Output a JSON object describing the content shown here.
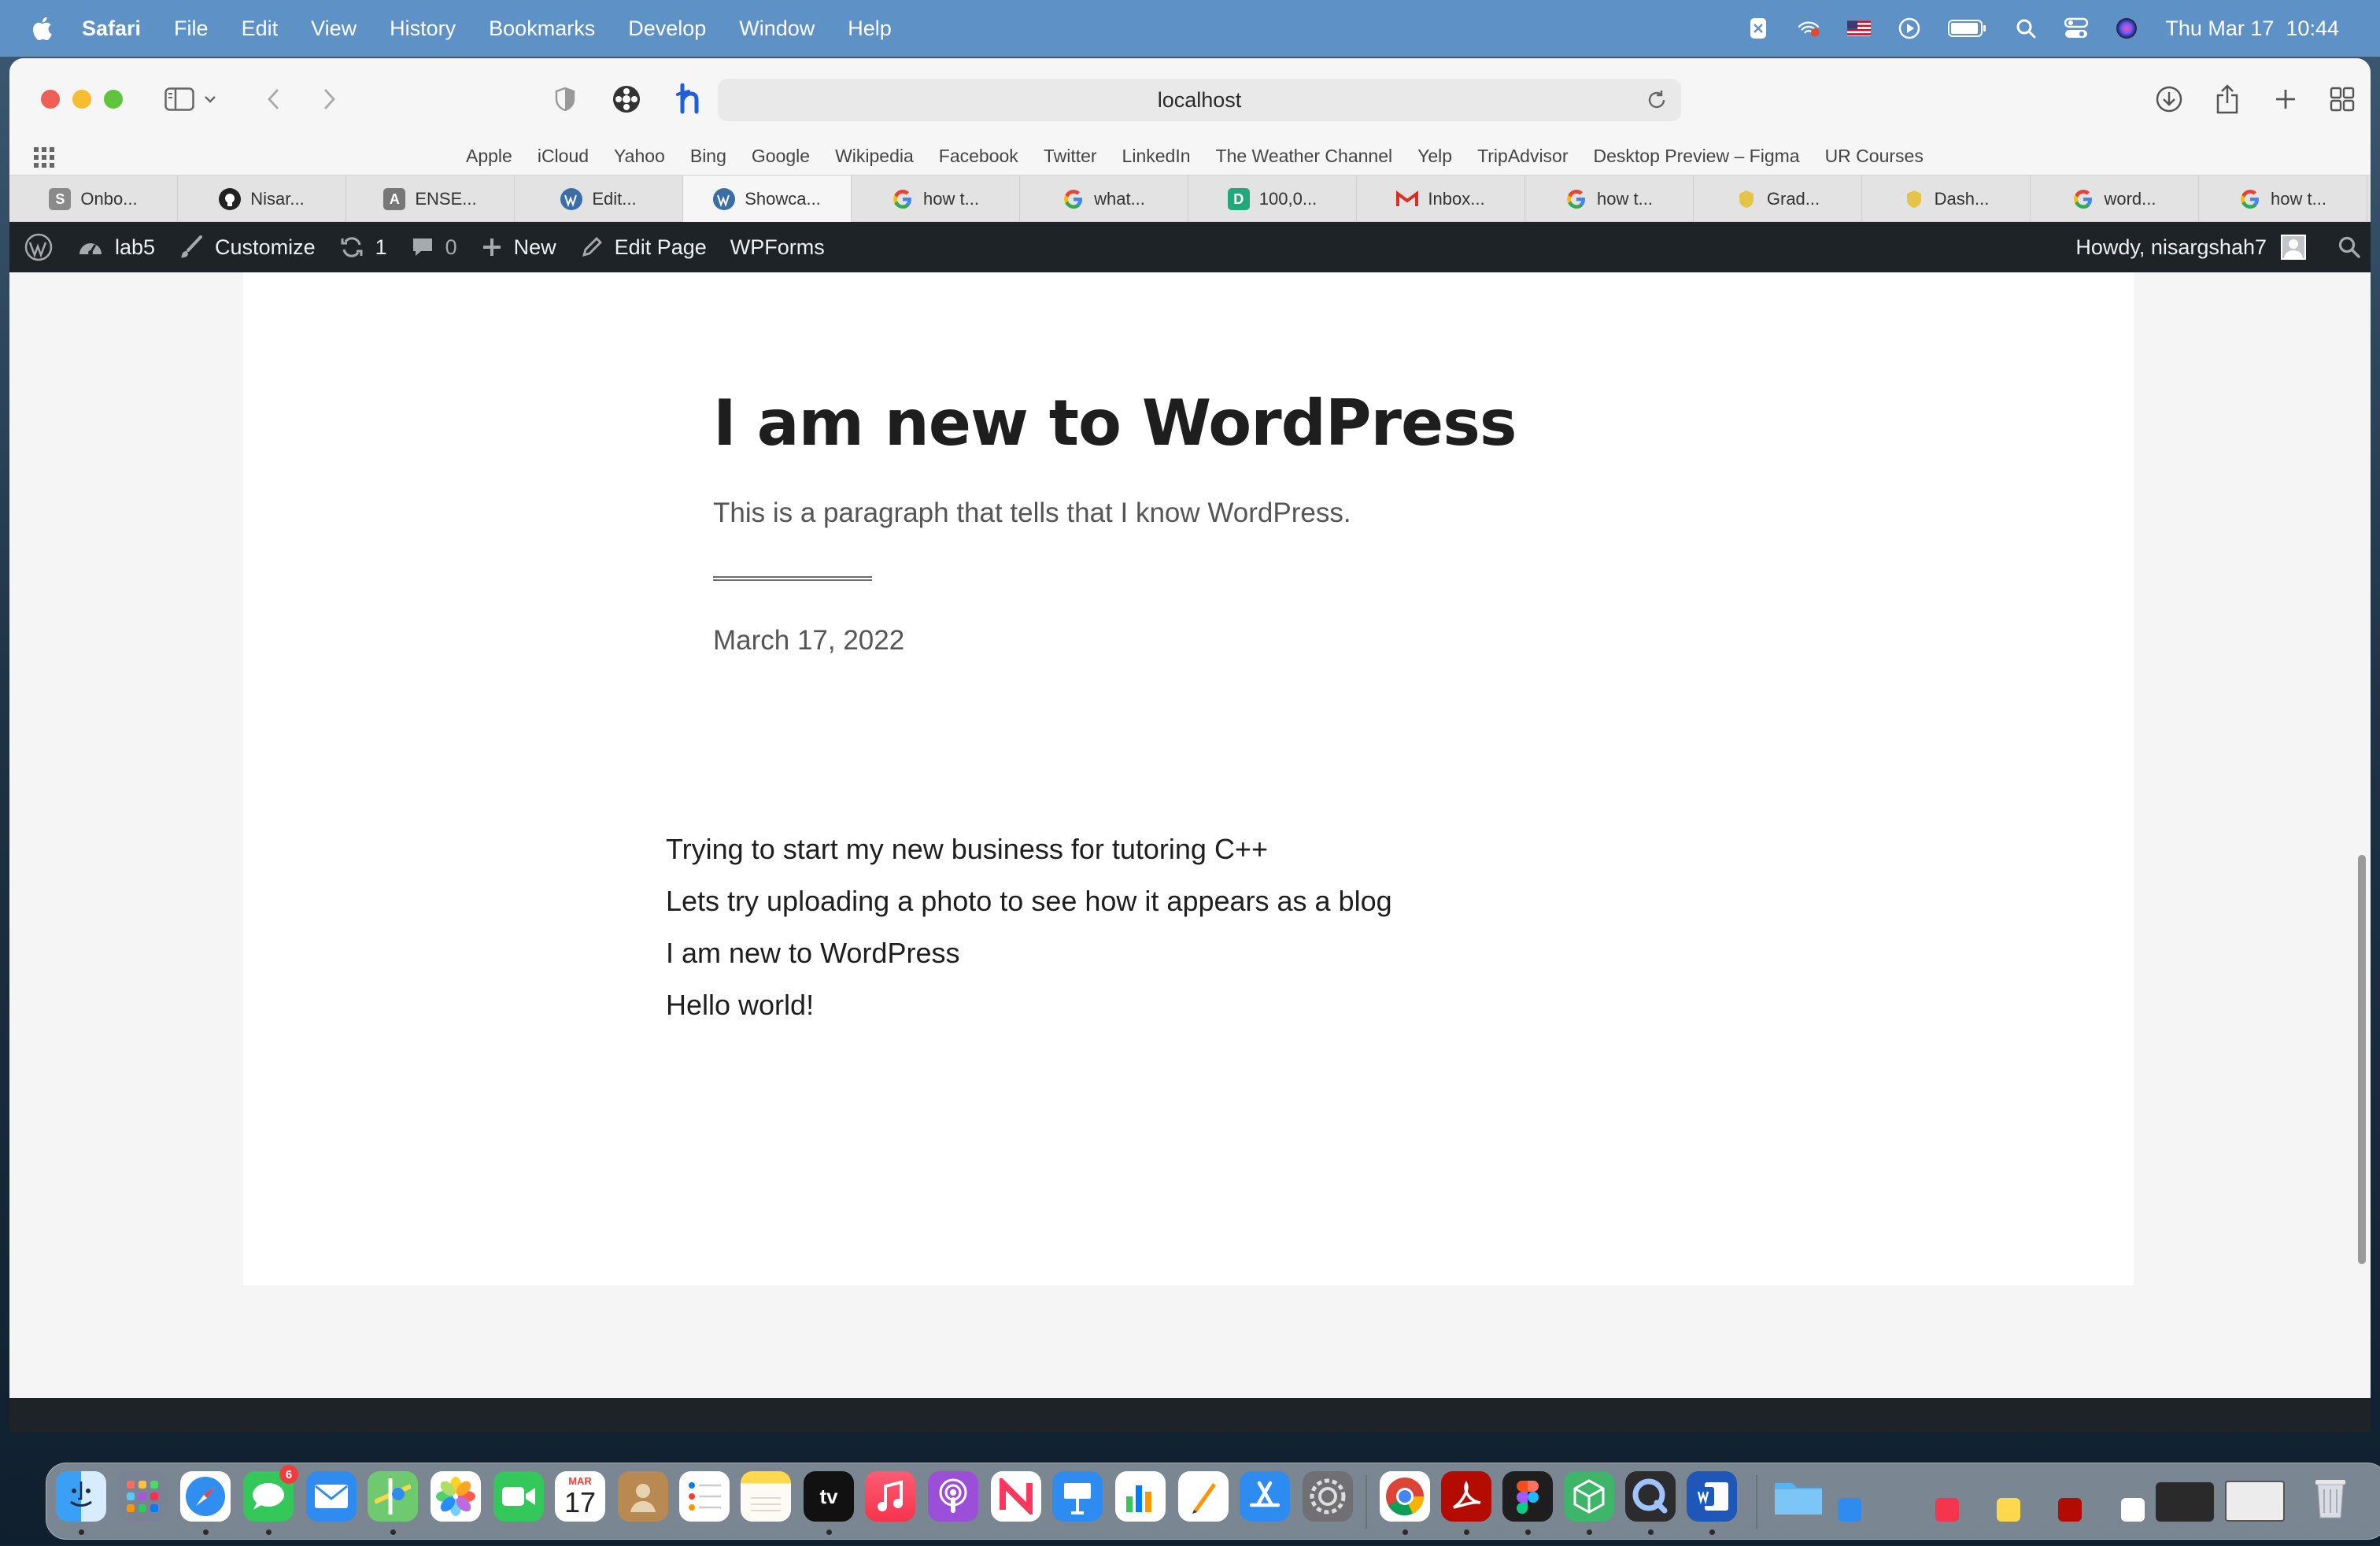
{
  "menubar": {
    "app": "Safari",
    "items": [
      "File",
      "Edit",
      "View",
      "History",
      "Bookmarks",
      "Develop",
      "Window",
      "Help"
    ],
    "datetime": "Thu Mar 17  10:44",
    "status_icons": [
      "extension-icon",
      "wifi-icon",
      "flag-icon",
      "play-icon",
      "battery-icon",
      "spotlight-icon",
      "control-center-icon",
      "siri-icon"
    ]
  },
  "browser": {
    "address": "localhost",
    "favorites": [
      "Apple",
      "iCloud",
      "Yahoo",
      "Bing",
      "Google",
      "Wikipedia",
      "Facebook",
      "Twitter",
      "LinkedIn",
      "The Weather Channel",
      "Yelp",
      "TripAdvisor",
      "Desktop Preview – Figma",
      "UR Courses"
    ],
    "tabs": [
      {
        "label": "Onbo...",
        "icon": "S",
        "color": "#8a8a8a"
      },
      {
        "label": "Nisar...",
        "icon": "github",
        "color": "#222222"
      },
      {
        "label": "ENSE...",
        "icon": "A",
        "color": "#777777"
      },
      {
        "label": "Edit...",
        "icon": "wordpress",
        "color": "#3a6ea5"
      },
      {
        "label": "Showca...",
        "icon": "wordpress",
        "color": "#3a6ea5"
      },
      {
        "label": "how t...",
        "icon": "google",
        "color": "#4285f4"
      },
      {
        "label": "what...",
        "icon": "google",
        "color": "#4285f4"
      },
      {
        "label": "100,0...",
        "icon": "D",
        "color": "#21a87b"
      },
      {
        "label": "Inbox...",
        "icon": "gmail",
        "color": "#d93025"
      },
      {
        "label": "how t...",
        "icon": "google",
        "color": "#4285f4"
      },
      {
        "label": "Grad...",
        "icon": "shield",
        "color": "#2b2b1c"
      },
      {
        "label": "Dash...",
        "icon": "shield",
        "color": "#2b2b1c"
      },
      {
        "label": "word...",
        "icon": "google",
        "color": "#4285f4"
      },
      {
        "label": "how t...",
        "icon": "google",
        "color": "#4285f4"
      }
    ]
  },
  "wp_admin_bar": {
    "site": "lab5",
    "customize": "Customize",
    "updates": "1",
    "comments": "0",
    "new": "New",
    "edit_page": "Edit Page",
    "wpforms": "WPForms",
    "howdy": "Howdy, nisargshah7"
  },
  "page": {
    "title": "I am new to WordPress",
    "excerpt": "This is a paragraph that tells that I know WordPress.",
    "date": "March 17, 2022",
    "latest_posts": [
      "Trying to start my new business for tutoring C++",
      "Lets try uploading a photo to see how it appears as a blog",
      "I am new to WordPress",
      "Hello world!"
    ]
  },
  "dock": {
    "calendar_month": "MAR",
    "calendar_day": "17",
    "messages_badge": "6",
    "tv_label": "tv"
  }
}
